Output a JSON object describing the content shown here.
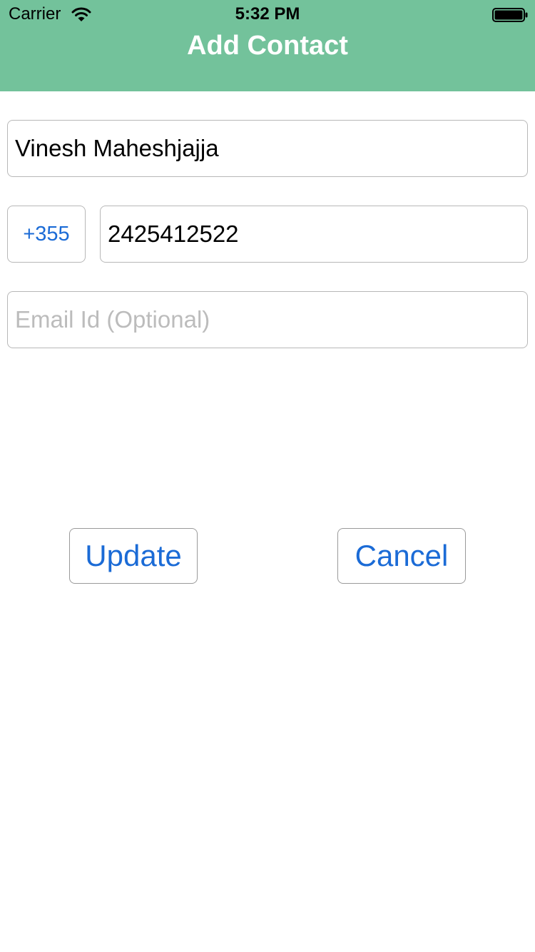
{
  "status_bar": {
    "carrier": "Carrier",
    "time": "5:32 PM"
  },
  "nav": {
    "title": "Add Contact"
  },
  "form": {
    "name_value": "Vinesh Maheshjajja",
    "country_code": "+355",
    "phone_value": "2425412522",
    "email_placeholder": "Email Id (Optional)",
    "email_value": ""
  },
  "buttons": {
    "update_label": "Update",
    "cancel_label": "Cancel"
  },
  "colors": {
    "header": "#73c29b",
    "accent": "#1b6bd6"
  },
  "icons": {
    "wifi": "wifi-icon",
    "battery": "battery-icon"
  }
}
